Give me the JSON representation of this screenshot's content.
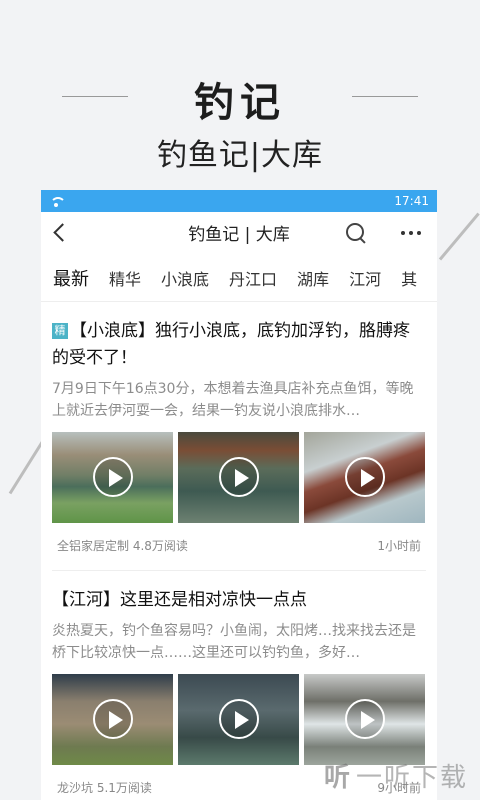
{
  "hero": {
    "title": "钓记",
    "subtitle": "钓鱼记|大库"
  },
  "status": {
    "time": "17:41"
  },
  "nav": {
    "title": "钓鱼记 | 大库"
  },
  "tabs": [
    "最新",
    "精华",
    "小浪底",
    "丹江口",
    "湖库",
    "江河",
    "其"
  ],
  "articles": [
    {
      "badge": "精",
      "title": "【小浪底】独行小浪底，底钓加浮钓，胳膊疼的受不了！",
      "excerpt": "7月9日下午16点30分，本想着去渔具店补充点鱼饵，等晚上就近去伊河耍一会，结果一钓友说小浪底排水…",
      "author_views": "全铝家居定制 4.8万阅读",
      "time": "1小时前"
    },
    {
      "title": "【江河】这里还是相对凉快一点点",
      "excerpt": "炎热夏天，钓个鱼容易吗？小鱼闹，太阳烤…找来找去还是桥下比较凉快一点……这里还可以钓钓鱼，多好…",
      "author_views": "龙沙坑 5.1万阅读",
      "time": "9小时前"
    }
  ],
  "watermark": {
    "logo": "听",
    "text": "一听下载"
  }
}
